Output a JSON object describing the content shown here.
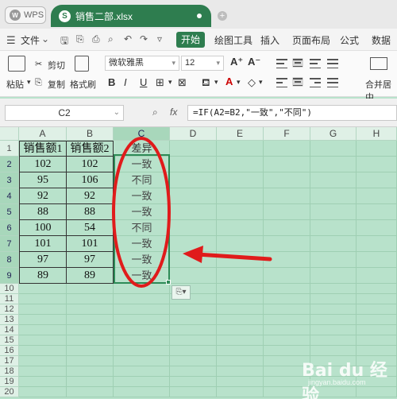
{
  "tabs": {
    "app": "WPS",
    "file": "销售二部.xlsx",
    "file_icon": "S"
  },
  "menu": {
    "file": "文件",
    "start": "开始",
    "items": [
      "绘图工具",
      "插入",
      "页面布局",
      "公式",
      "数据"
    ]
  },
  "ribbon": {
    "paste": "粘贴",
    "cut": "剪切",
    "copy": "复制",
    "format_painter": "格式刷",
    "font_name": "微软雅黑",
    "font_size": "12",
    "grow": "A⁺",
    "shrink": "A⁻",
    "bold": "B",
    "italic": "I",
    "underline": "U",
    "merge": "合并居中"
  },
  "formula_bar": {
    "name_box": "C2",
    "fx": "fx",
    "formula": "=IF(A2=B2,\"一致\",\"不同\")"
  },
  "grid": {
    "columns": [
      "A",
      "B",
      "C",
      "D",
      "E",
      "F",
      "G",
      "H"
    ],
    "rows": [
      "1",
      "2",
      "3",
      "4",
      "5",
      "6",
      "7",
      "8",
      "9",
      "10",
      "11",
      "12",
      "13",
      "14",
      "15",
      "16",
      "17",
      "18",
      "19",
      "20"
    ],
    "header": {
      "a": "销售额1",
      "b": "销售额2",
      "c": "差异"
    },
    "data": [
      {
        "a": "102",
        "b": "102",
        "c": "一致"
      },
      {
        "a": "95",
        "b": "106",
        "c": "不同"
      },
      {
        "a": "92",
        "b": "92",
        "c": "一致"
      },
      {
        "a": "88",
        "b": "88",
        "c": "一致"
      },
      {
        "a": "100",
        "b": "54",
        "c": "不同"
      },
      {
        "a": "101",
        "b": "101",
        "c": "一致"
      },
      {
        "a": "97",
        "b": "97",
        "c": "一致"
      },
      {
        "a": "89",
        "b": "89",
        "c": "一致"
      }
    ]
  },
  "annotation": {
    "ellipse_color": "#e01b1b",
    "arrow_color": "#e01b1b"
  },
  "watermark": {
    "text": "Bai du 经验",
    "sub": "jingyan.baidu.com"
  },
  "colors": {
    "accent": "#2e7d4f",
    "sheet_bg": "#b8e2cb"
  }
}
